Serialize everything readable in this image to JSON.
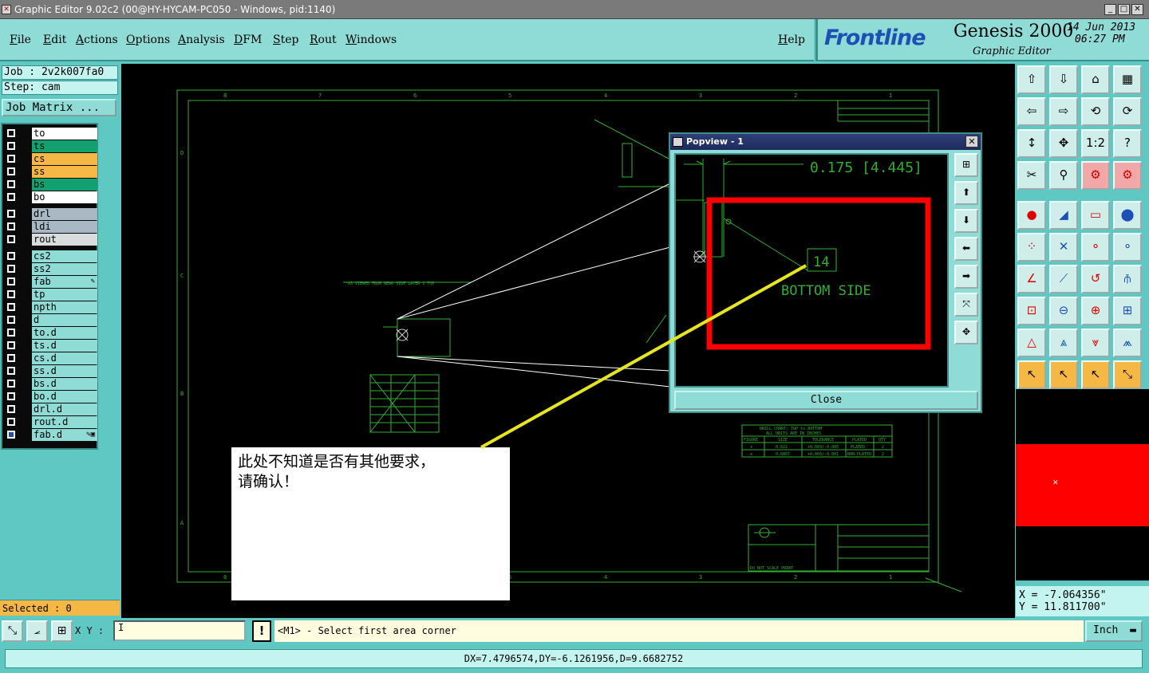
{
  "window": {
    "title": "Graphic Editor 9.02c2 (00@HY-HYCAM-PC050 - Windows, pid:1140)",
    "min": "_",
    "max": "□",
    "close": "✕"
  },
  "menu": [
    "File",
    "Edit",
    "Actions",
    "Options",
    "Analysis",
    "DFM",
    "Step",
    "Rout",
    "Windows"
  ],
  "help": "Help",
  "brand": {
    "logo": "Frontline",
    "product": "Genesis 2000",
    "subtitle": "Graphic Editor",
    "date": "14 Jun 2013",
    "time": "06:27 PM"
  },
  "job": {
    "job_label": "Job : 2v2k007fa0",
    "step_label": "Step: cam",
    "matrix_button": "Job Matrix ..."
  },
  "layers": [
    {
      "name": "to",
      "color": "#ffffff",
      "mark": ""
    },
    {
      "name": "ts",
      "color": "#12a070",
      "mark": ""
    },
    {
      "name": "cs",
      "color": "#f6b844",
      "mark": ""
    },
    {
      "name": "ss",
      "color": "#f6b844",
      "mark": ""
    },
    {
      "name": "bs",
      "color": "#12a070",
      "mark": ""
    },
    {
      "name": "bo",
      "color": "#ffffff",
      "mark": ""
    },
    {
      "name": "drl",
      "color": "#a8b8c4",
      "mark": ""
    },
    {
      "name": "ldi",
      "color": "#a8b8c4",
      "mark": ""
    },
    {
      "name": "rout",
      "color": "#d8dcdc",
      "mark": ""
    },
    {
      "name": "cs2",
      "color": "#8fdcd6",
      "mark": ""
    },
    {
      "name": "ss2",
      "color": "#8fdcd6",
      "mark": ""
    },
    {
      "name": "fab",
      "color": "#8fdcd6",
      "mark": "✎"
    },
    {
      "name": "tp",
      "color": "#8fdcd6",
      "mark": ""
    },
    {
      "name": "npth",
      "color": "#8fdcd6",
      "mark": ""
    },
    {
      "name": "d",
      "color": "#8fdcd6",
      "mark": ""
    },
    {
      "name": "to.d",
      "color": "#8fdcd6",
      "mark": ""
    },
    {
      "name": "ts.d",
      "color": "#8fdcd6",
      "mark": ""
    },
    {
      "name": "cs.d",
      "color": "#8fdcd6",
      "mark": ""
    },
    {
      "name": "ss.d",
      "color": "#8fdcd6",
      "mark": ""
    },
    {
      "name": "bs.d",
      "color": "#8fdcd6",
      "mark": ""
    },
    {
      "name": "bo.d",
      "color": "#8fdcd6",
      "mark": ""
    },
    {
      "name": "drl.d",
      "color": "#8fdcd6",
      "mark": ""
    },
    {
      "name": "rout.d",
      "color": "#8fdcd6",
      "mark": ""
    },
    {
      "name": "fab.d",
      "color": "#8fdcd6",
      "mark": "✎▣"
    }
  ],
  "selected": "Selected : 0",
  "popview": {
    "title": "Popview - 1",
    "close_label": "Close",
    "dimension": "0.175 [4.445]",
    "ref_number": "14",
    "ref_label": "BOTTOM SIDE"
  },
  "note": {
    "line1": "此处不知道是否有其他要求，",
    "line2": "请确认！"
  },
  "coords": {
    "x": "X = -7.064356\"",
    "y": "Y = 11.811700\""
  },
  "input": {
    "xy_label": "X Y :",
    "xy_value": "I",
    "warn": "!",
    "prompt": "<M1> - Select first area corner",
    "unit": "Inch"
  },
  "status": "DX=7.4796574,DY=-6.1261956,D=9.6682752",
  "drawing": {
    "columns": [
      "8",
      "7",
      "6",
      "5",
      "4",
      "3",
      "2",
      "1"
    ],
    "rows": [
      "D",
      "C",
      "B",
      "A"
    ],
    "fab_note": "AS VIEWED FROM NEAR SIDE  LAYER 1 TOP",
    "drill_chart_title": "DRILL CHART: TOP to BOTTOM",
    "drill_chart_sub": "ALL UNITS ARE IN INCHES",
    "drill_headers": [
      "FIGURE",
      "SIZE",
      "TOLERANCE",
      "PLATED",
      "QTY"
    ],
    "drill_rows": [
      [
        "+",
        "0.022",
        "+0.003/-0.005",
        "PLATED",
        "2"
      ],
      [
        "x",
        "0.0867",
        "+0.003/-0.001",
        "NON-PLATED",
        "2"
      ]
    ],
    "tb_title": "DO NOT SCALE PRINT"
  }
}
